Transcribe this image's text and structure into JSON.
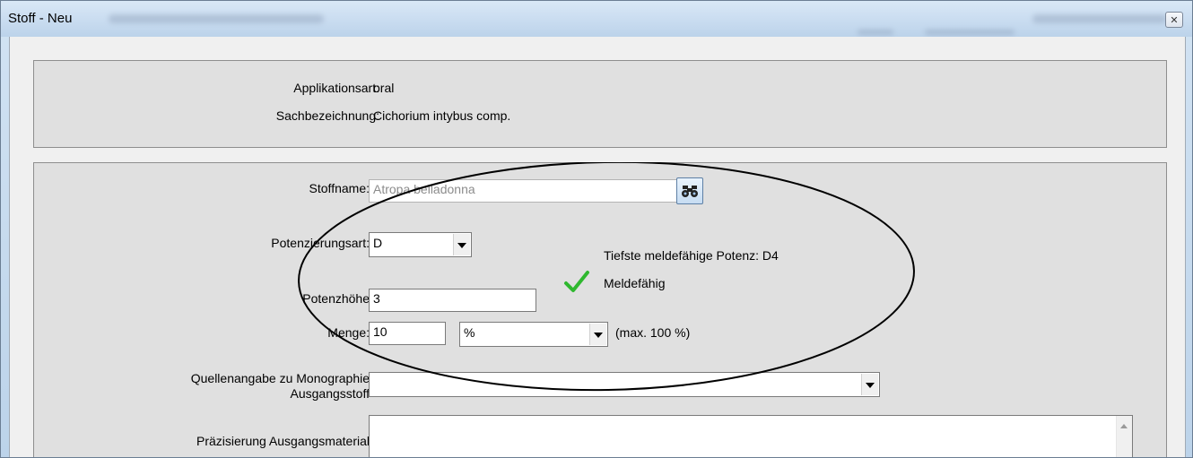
{
  "window": {
    "title": "Stoff - Neu",
    "close_glyph": "✕"
  },
  "info": {
    "applikationsart_label": "Applikationsart:",
    "applikationsart_value": "oral",
    "sachbezeichnung_label": "Sachbezeichnung:",
    "sachbezeichnung_value": "Cichorium intybus comp."
  },
  "form": {
    "stoffname_label": "Stoffname:",
    "stoffname_value": "Atropa belladonna",
    "search_icon": "binoculars-icon",
    "potenzierungsart_label": "Potenzierungsart:",
    "potenzierungsart_value": "D",
    "potenzhoehe_label": "Potenzhöhe",
    "potenzhoehe_value": "3",
    "menge_label": "Menge:",
    "menge_value": "10",
    "menge_unit": "%",
    "menge_hint": "(max. 100 %)",
    "tiefste_text": "Tiefste meldefähige Potenz: D4",
    "meldefaehig_text": "Meldefähig",
    "check_icon": "checkmark-icon",
    "check_color": "#2fb82f",
    "quelle_label_line1": "Quellenangabe zu Monographie",
    "quelle_label_line2": "Ausgangsstoff",
    "quelle_value": "",
    "praezisierung_label": "Präzisierung Ausgangsmaterial",
    "praezisierung_value": ""
  }
}
